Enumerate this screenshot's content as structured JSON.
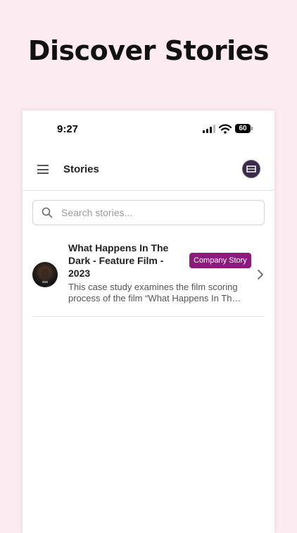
{
  "headline": "Discover Stories",
  "status_bar": {
    "time": "9:27",
    "battery": "60"
  },
  "header": {
    "title": "Stories"
  },
  "search": {
    "placeholder": "Search stories...",
    "value": ""
  },
  "stories": [
    {
      "title_lines": [
        "What Happens In The",
        "Dark - Feature Film -",
        "2023"
      ],
      "badge": "Company Story",
      "description_lines": [
        "This case study examines the film scoring",
        "process of the film “What Happens In Th…"
      ]
    }
  ],
  "colors": {
    "background": "#fcebf0",
    "badge": "#8e1a7e"
  }
}
